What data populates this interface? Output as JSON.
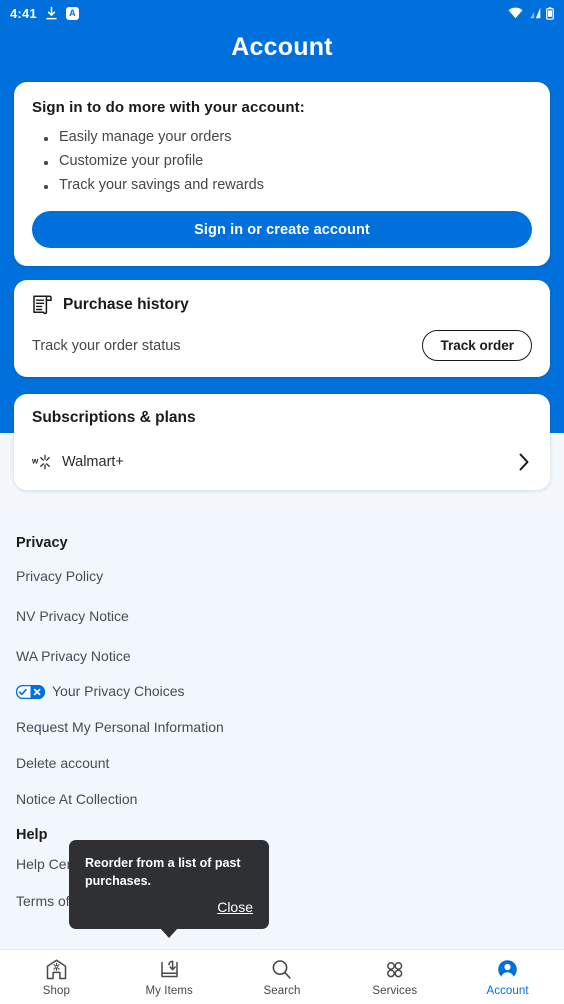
{
  "theme": {
    "brand_blue": "#0071DC",
    "lower_bg": "#f2f6fd",
    "tooltip_bg": "#2e3034"
  },
  "status_bar": {
    "time": "4:41",
    "left_icons": [
      "download-icon",
      "a-badge-icon"
    ],
    "a_badge_letter": "A",
    "right_icons": [
      "wifi-icon",
      "cellular-signal-icon",
      "battery-icon"
    ]
  },
  "header": {
    "title": "Account"
  },
  "signin_card": {
    "heading": "Sign in to do more with your account:",
    "benefits": [
      "Easily manage your orders",
      "Customize your profile",
      "Track your savings and rewards"
    ],
    "button_label": "Sign in or create account"
  },
  "purchase_card": {
    "icon": "receipt-icon",
    "title": "Purchase history",
    "subtitle": "Track your order status",
    "button_label": "Track order"
  },
  "subscriptions_card": {
    "title": "Subscriptions & plans",
    "items": [
      {
        "icon": "walmart-plus-icon",
        "label": "Walmart+",
        "chevron": "chevron-right-icon"
      }
    ]
  },
  "privacy_section": {
    "heading": "Privacy",
    "items": [
      {
        "label": "Privacy Policy",
        "icon": null
      },
      {
        "label": "NV Privacy Notice",
        "icon": null
      },
      {
        "label": "WA Privacy Notice",
        "icon": null
      },
      {
        "label": "Your Privacy Choices",
        "icon": "privacy-choices-icon"
      },
      {
        "label": "Request My Personal Information",
        "icon": null
      },
      {
        "label": "Delete account",
        "icon": null
      },
      {
        "label": "Notice At Collection",
        "icon": null
      }
    ]
  },
  "help_section": {
    "heading": "Help",
    "items": [
      {
        "label": "Help Center"
      },
      {
        "label": "Terms of Use"
      }
    ]
  },
  "tooltip": {
    "text": "Reorder from a list of past purchases.",
    "close_label": "Close"
  },
  "bottom_nav": {
    "items": [
      {
        "label": "Shop",
        "icon": "storefront-icon",
        "active": false
      },
      {
        "label": "My Items",
        "icon": "tray-download-icon",
        "active": false
      },
      {
        "label": "Search",
        "icon": "search-icon",
        "active": false
      },
      {
        "label": "Services",
        "icon": "grid-circles-icon",
        "active": false
      },
      {
        "label": "Account",
        "icon": "account-circle-icon",
        "active": true
      }
    ]
  }
}
